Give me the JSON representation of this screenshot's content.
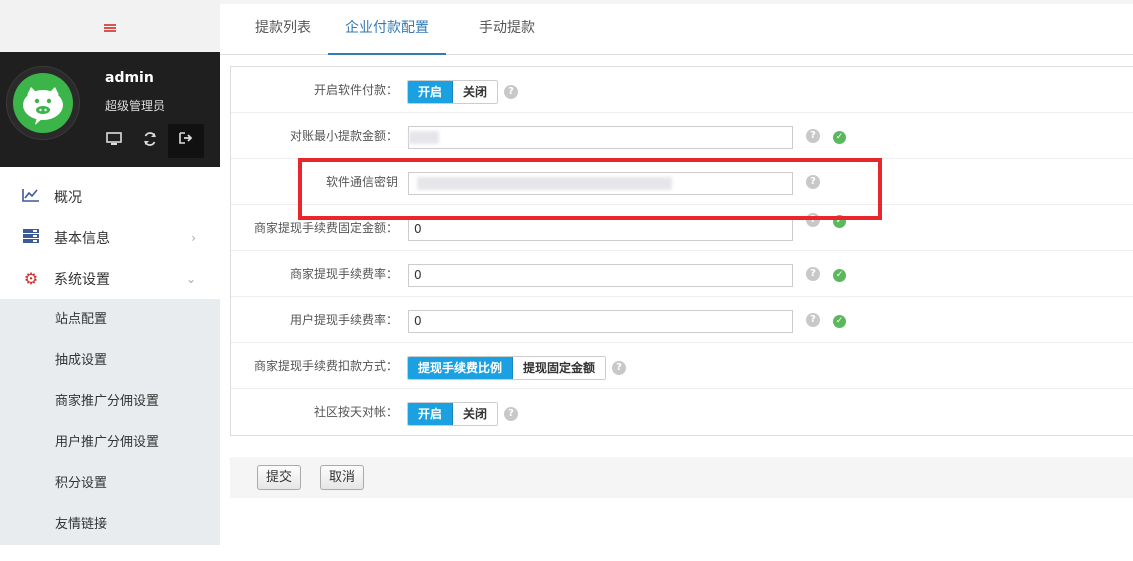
{
  "sidebar": {
    "username": "admin",
    "role": "超级管理员",
    "menu": [
      {
        "label": "概况",
        "icon": "chart-line-icon"
      },
      {
        "label": "基本信息",
        "icon": "server-icon"
      },
      {
        "label": "系统设置",
        "icon": "gear-icon"
      }
    ],
    "submenu": [
      "站点配置",
      "抽成设置",
      "商家推广分佣设置",
      "用户推广分佣设置",
      "积分设置",
      "友情链接"
    ]
  },
  "tabs": [
    "提款列表",
    "企业付款配置",
    "手动提款"
  ],
  "active_tab": "企业付款配置",
  "form": {
    "enable_software_pay": {
      "label": "开启软件付款：",
      "on": "开启",
      "off": "关闭"
    },
    "min_withdraw": {
      "label": "对账最小提款金额："
    },
    "secret_key": {
      "label": "软件通信密钥"
    },
    "merchant_fixed_fee": {
      "label": "商家提现手续费固定金额：",
      "value": "0"
    },
    "merchant_fee_rate": {
      "label": "商家提现手续费率：",
      "value": "0"
    },
    "user_fee_rate": {
      "label": "用户提现手续费率：",
      "value": "0"
    },
    "deduct_method": {
      "label": "商家提现手续费扣款方式：",
      "opt1": "提现手续费比例",
      "opt2": "提现固定金额"
    },
    "community_daily": {
      "label": "社区按天对帐：",
      "on": "开启",
      "off": "关闭"
    }
  },
  "buttons": {
    "submit": "提交",
    "cancel": "取消"
  },
  "colors": {
    "accent": "#1ba1e2",
    "highlight": "#e8262b",
    "ok": "#5cb85c"
  }
}
